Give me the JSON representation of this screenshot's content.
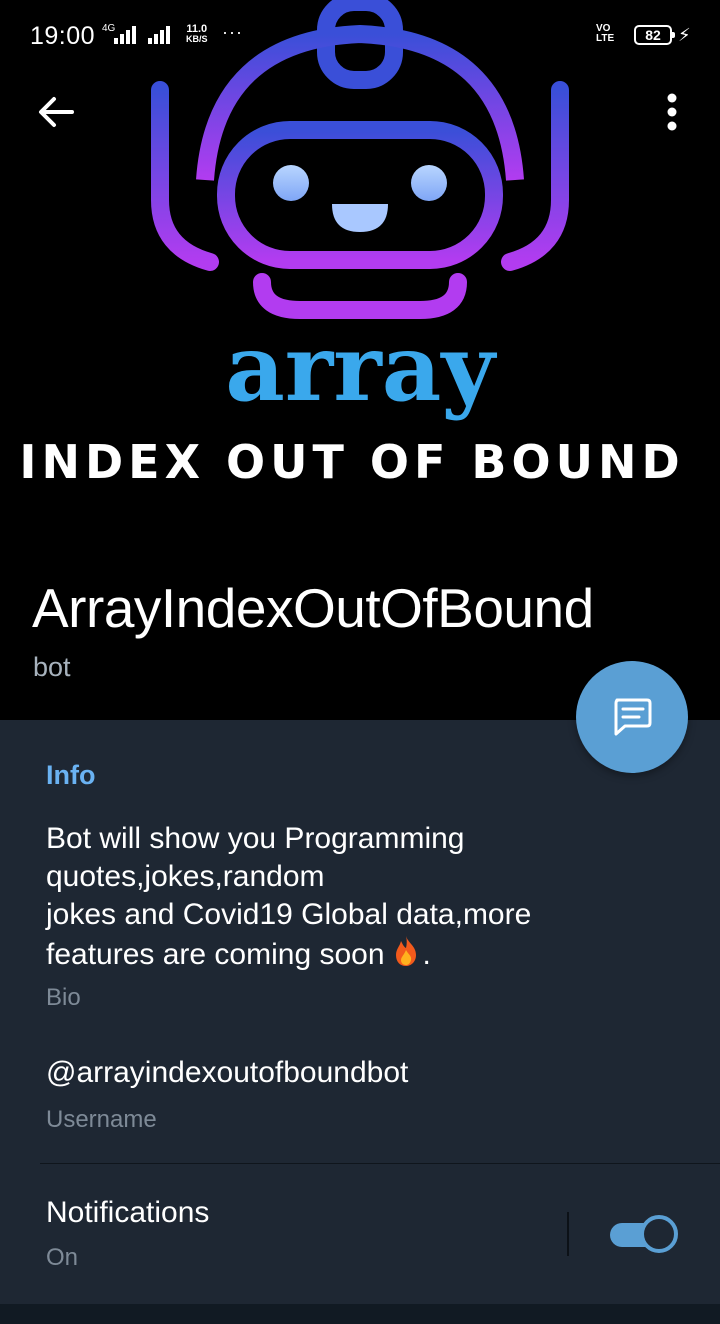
{
  "status_bar": {
    "time": "19:00",
    "network_small": "4G",
    "speed_value": "11.0",
    "speed_unit": "KB/S",
    "more_dots": "···",
    "volte_top": "VO",
    "volte_bottom": "LTE",
    "battery": "82",
    "charging": "⚡"
  },
  "header": {
    "back_icon": "arrow-left-icon",
    "more_icon": "more-vertical-icon"
  },
  "logo": {
    "word": "array",
    "tagline": "INDEX OUT OF BOUND",
    "colors": {
      "robot_top": "#3a4fd8",
      "robot_bottom": "#b23cf0",
      "word": "#3aa8ec",
      "eye": "#9fc3ff"
    }
  },
  "profile": {
    "name": "ArrayIndexOutOfBound",
    "type": "bot"
  },
  "fab": {
    "icon": "message-icon",
    "color": "#5a9fd4"
  },
  "info": {
    "title": "Info",
    "bio_lines": [
      "Bot will show you Programming",
      "quotes,jokes,random",
      "jokes and Covid19 Global data,more",
      "features are coming soon"
    ],
    "bio_end": ".",
    "bio_emoji": "fire-icon",
    "bio_label": "Bio",
    "username": "@arrayindexoutofboundbot",
    "username_label": "Username",
    "notifications_title": "Notifications",
    "notifications_status": "On",
    "notifications_enabled": true,
    "accent": "#6ab2f2"
  }
}
